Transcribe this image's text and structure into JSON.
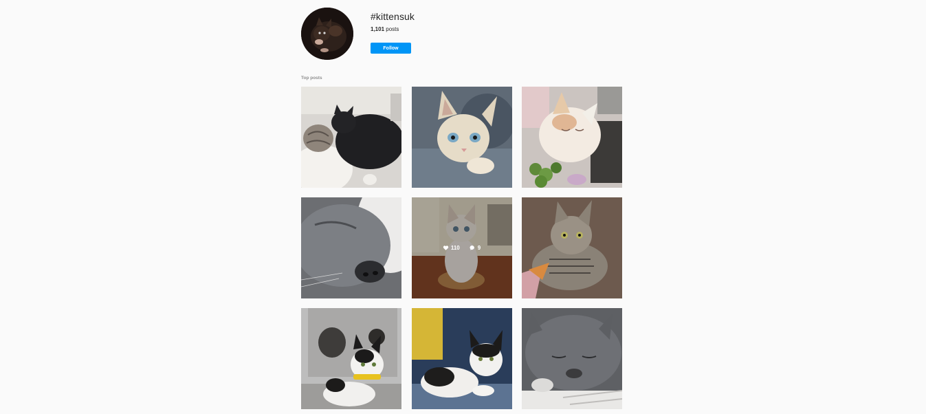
{
  "header": {
    "hashtag": "#kittensuk",
    "post_count": "1,101",
    "post_count_suffix": " posts",
    "follow_label": "Follow",
    "avatar_icon": "cat-avatar-image"
  },
  "top_posts": {
    "label": "Top posts",
    "items": [
      {
        "alt": "grey-and-black-kittens-sleeping"
      },
      {
        "alt": "blue-eyed-cream-kitten"
      },
      {
        "alt": "cream-kitten-sleeping-with-plants"
      },
      {
        "alt": "grey-cat-nose-closeup"
      },
      {
        "alt": "cream-kitten-on-table",
        "likes": "110",
        "comments": "9"
      },
      {
        "alt": "tabby-kitten-on-carpet"
      },
      {
        "alt": "black-white-kitten-yellow-collar"
      },
      {
        "alt": "black-white-kitten-on-blanket"
      },
      {
        "alt": "grey-cat-sleeping"
      }
    ]
  },
  "colors": {
    "accent": "#0095f6",
    "background": "#fafafa"
  }
}
